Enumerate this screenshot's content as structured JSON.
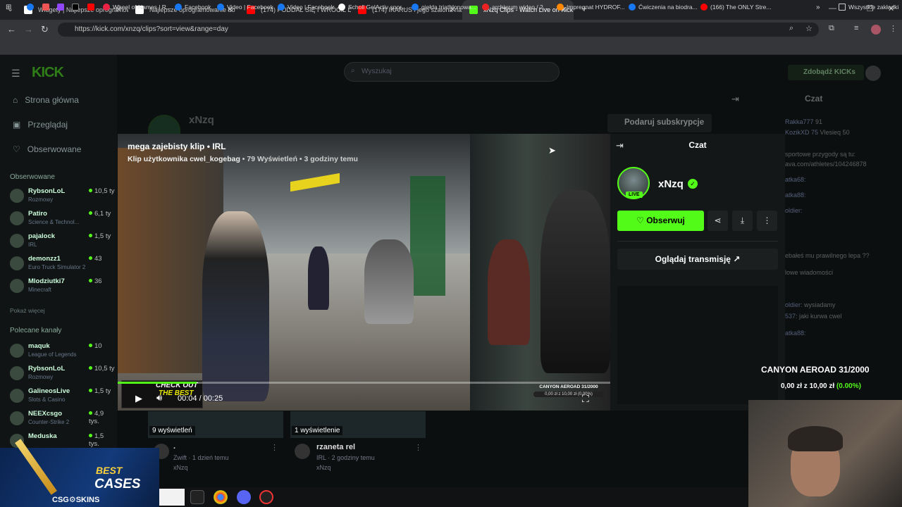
{
  "browser": {
    "tabs": [
      {
        "title": "Widgety | Najlepsze oprogramowanie",
        "color": "#ffffff"
      },
      {
        "title": "Najlepsze oprogramowanie do",
        "color": "#ffffff"
      },
      {
        "title": "(174) PODDAŁ SIĘ I WRÓCIŁ DO",
        "color": "#ff0000"
      },
      {
        "title": "(174) IKARUS i jego szalona na",
        "color": "#ff0000"
      },
      {
        "title": "xNzq Clips - Watch Live on Kick",
        "color": "#53fc18"
      }
    ],
    "url": "https://kick.com/xnzq/clips?sort=view&range=day",
    "bookmarks": [
      {
        "label": "Wheel of Names | R...",
        "color": "#e24"
      },
      {
        "label": "Facebook",
        "color": "#1877f2"
      },
      {
        "label": "Video | Facebook",
        "color": "#1877f2"
      },
      {
        "label": "Video | Facebook",
        "color": "#1877f2"
      },
      {
        "label": "Scholl GelActiv spor...",
        "color": "#ffffff"
      },
      {
        "label": "giełda triathlonowa...",
        "color": "#1877f2"
      },
      {
        "label": "archiwum wideo / 2...",
        "color": "#e22"
      },
      {
        "label": "Impregnat HYDROF...",
        "color": "#f80"
      },
      {
        "label": "Ćwiczenia na biodra...",
        "color": "#1877f2"
      },
      {
        "label": "(166) The ONLY Stre...",
        "color": "#f00"
      }
    ],
    "all_bookmarks": "Wszystkie zakładki"
  },
  "kick": {
    "logo": "KICK",
    "search_placeholder": "Wyszukaj",
    "kicks_button": "Zdobądź KICKs",
    "nav": [
      {
        "label": "Strona główna",
        "icon": "home-icon",
        "glyph": "⌂"
      },
      {
        "label": "Przeglądaj",
        "icon": "browse-icon",
        "glyph": "▣"
      },
      {
        "label": "Obserwowane",
        "icon": "heart-icon",
        "glyph": "♡"
      }
    ],
    "followed_heading": "Obserwowane",
    "followed": [
      {
        "name": "RybsonLoL",
        "cat": "Rozmowy",
        "viewers": "10,5 ty"
      },
      {
        "name": "Patiro",
        "cat": "Science & Technol...",
        "viewers": "6,1 ty"
      },
      {
        "name": "pajalock",
        "cat": "IRL",
        "viewers": "1,5 ty"
      },
      {
        "name": "demonzz1",
        "cat": "Euro Truck Simulator 2",
        "viewers": "43"
      },
      {
        "name": "Mlodziutki7",
        "cat": "Minecraft",
        "viewers": "36"
      }
    ],
    "show_more": "Pokaż więcej",
    "recommended_heading": "Polecane kanały",
    "recommended": [
      {
        "name": "maquk",
        "cat": "League of Legends",
        "viewers": "10"
      },
      {
        "name": "RybsonLoL",
        "cat": "Rozmowy",
        "viewers": "10,5 ty"
      },
      {
        "name": "GalineosLive",
        "cat": "Slots & Casino",
        "viewers": "1,5 ty"
      },
      {
        "name": "NEEXcsgo",
        "cat": "Counter-Strike 2",
        "viewers": "4,9 tys."
      },
      {
        "name": "Meduska",
        "cat": "",
        "viewers": "1,5 tys."
      }
    ],
    "bg_streamer": "xNzq",
    "gift_sub": "Podaruj subskrypcje"
  },
  "clip": {
    "title": "mega zajebisty klip • IRL",
    "author_line": "Klip użytkownika cwel_kogebag",
    "meta": "• 79 Wyświetleń • 3 godziny temu",
    "time": "00:04 / 00:25",
    "progress": 0.16,
    "overlay_title": "CANYON AEROAD 31/2000",
    "overlay_sub": "0,00 zł z 10,00 zł (0.00%)"
  },
  "panel": {
    "title": "Czat",
    "username": "xNzq",
    "live": "LIVE",
    "follow": "Obserwuj",
    "watch": "Oglądaj transmisję"
  },
  "right_chat": {
    "title": "Czat",
    "lines": [
      {
        "u": "Rakka777",
        "t": "91"
      },
      {
        "u": "KozikXD 75",
        "t": "Vlesieq 50"
      },
      {
        "u": "",
        "t": "sportowe przygody są tu:"
      },
      {
        "u": "",
        "t": "ava.com/athletes/104246878"
      },
      {
        "u": "atka68:",
        "t": ""
      },
      {
        "u": "atka88:",
        "t": ""
      },
      {
        "u": "oldier:",
        "t": ""
      },
      {
        "u": "",
        "t": "ebałeś mu prawilnego lepa ??"
      },
      {
        "u": "",
        "t": "lowe wiadomości"
      },
      {
        "u": "oldier:",
        "t": "wysiadamy"
      },
      {
        "u": "537:",
        "t": "jaki kurwa cwel"
      },
      {
        "u": "atka88:",
        "t": ""
      }
    ],
    "goal_title": "CANYON AEROAD 31/2000",
    "goal_amount": "0,00 zł z 10,00 zł",
    "goal_pct": "(0.00%)"
  },
  "cards": [
    {
      "views": "9 wyświetleń",
      "title": ".",
      "meta": "Zwift · 1 dzień temu",
      "author": "xNzq"
    },
    {
      "views": "1 wyświetlenie",
      "title": "rzaneta rel",
      "meta": "IRL · 2 godziny temu",
      "author": "xNzq"
    }
  ],
  "ad": {
    "best": "BEST",
    "cases": "CASES",
    "brand": "CSG⚙SKINS",
    "check": "CHECK OUT",
    "the_best": "THE BEST"
  }
}
